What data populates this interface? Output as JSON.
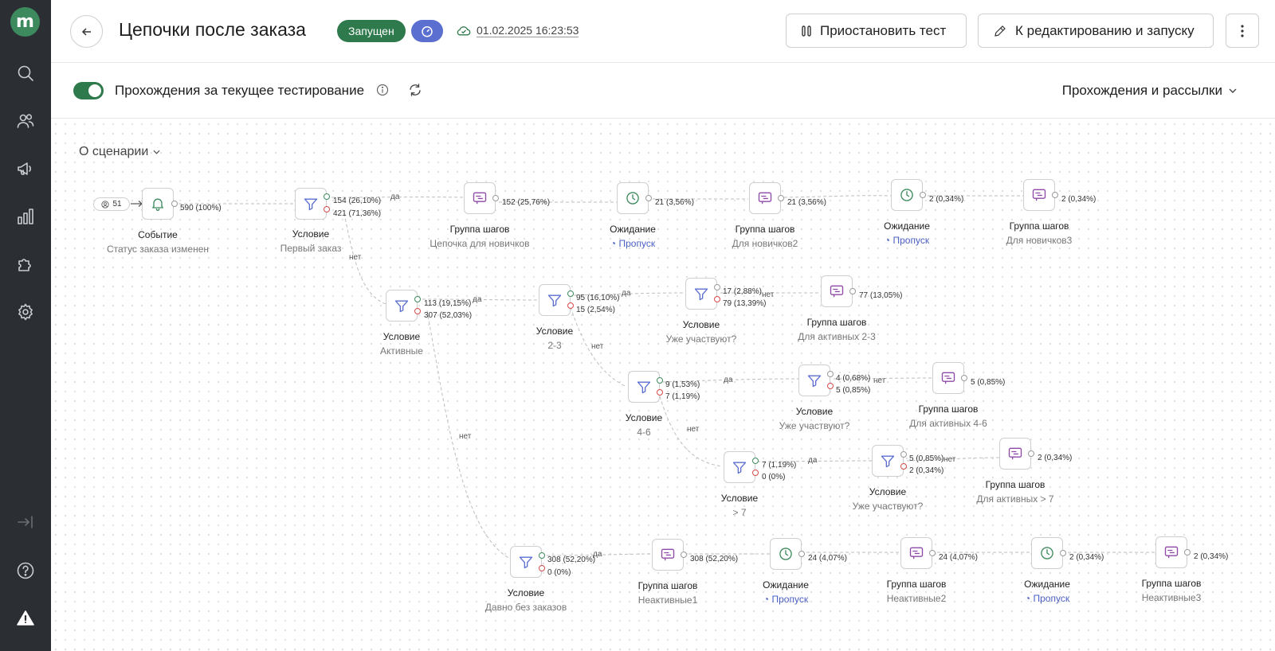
{
  "header": {
    "title": "Цепочки после заказа",
    "status": "Запущен",
    "saved_at": "01.02.2025 16:23:53",
    "pause_label": "Приостановить тест",
    "edit_label": "К редактированию и запуску"
  },
  "subbar": {
    "toggle_label": "Прохождения за текущее тестирование",
    "view_select": "Прохождения и рассылки"
  },
  "canvas": {
    "about_label": "О сценарии",
    "entry_count": "51",
    "edge_yes": "да",
    "edge_no": "нет",
    "skip_label": "Пропуск",
    "nodes": [
      {
        "id": "event",
        "title": "Событие",
        "sub": "Статус заказа изменен",
        "stats": [
          "590 (100%)"
        ]
      },
      {
        "id": "c1",
        "title": "Условие",
        "sub": "Первый заказ",
        "stats": [
          "154 (26,10%)",
          "421 (71,36%)"
        ]
      },
      {
        "id": "g1",
        "title": "Группа шагов",
        "sub": "Цепочка для новичков",
        "stats": [
          "152 (25,76%)"
        ]
      },
      {
        "id": "w1",
        "title": "Ожидание",
        "sub": "",
        "stats": [
          "21 (3,56%)"
        ]
      },
      {
        "id": "g2",
        "title": "Группа шагов",
        "sub": "Для новичков2",
        "stats": [
          "21 (3,56%)"
        ]
      },
      {
        "id": "w2",
        "title": "Ожидание",
        "sub": "",
        "stats": [
          "2 (0,34%)"
        ]
      },
      {
        "id": "g3",
        "title": "Группа шагов",
        "sub": "Для новичков3",
        "stats": [
          "2 (0,34%)"
        ]
      },
      {
        "id": "c2",
        "title": "Условие",
        "sub": "Активные",
        "stats": [
          "113 (19,15%)",
          "307 (52,03%)"
        ]
      },
      {
        "id": "c3",
        "title": "Условие",
        "sub": "2-3",
        "stats": [
          "95 (16,10%)",
          "15 (2,54%)"
        ]
      },
      {
        "id": "c4",
        "title": "Условие",
        "sub": "Уже участвуют?",
        "stats": [
          "17 (2,88%)",
          "79 (13,39%)"
        ]
      },
      {
        "id": "g4",
        "title": "Группа шагов",
        "sub": "Для активных 2-3",
        "stats": [
          "77 (13,05%)"
        ]
      },
      {
        "id": "c5",
        "title": "Условие",
        "sub": "4-6",
        "stats": [
          "9 (1,53%)",
          "7 (1,19%)"
        ]
      },
      {
        "id": "c6",
        "title": "Условие",
        "sub": "Уже участвуют?",
        "stats": [
          "4 (0,68%)",
          "5 (0,85%)"
        ]
      },
      {
        "id": "g5",
        "title": "Группа шагов",
        "sub": "Для активных 4-6",
        "stats": [
          "5 (0,85%)"
        ]
      },
      {
        "id": "c7",
        "title": "Условие",
        "sub": "> 7",
        "stats": [
          "7 (1,19%)",
          "0 (0%)"
        ]
      },
      {
        "id": "c8",
        "title": "Условие",
        "sub": "Уже участвуют?",
        "stats": [
          "5 (0,85%)",
          "2 (0,34%)"
        ]
      },
      {
        "id": "g6",
        "title": "Группа шагов",
        "sub": "Для активных > 7",
        "stats": [
          "2 (0,34%)"
        ]
      },
      {
        "id": "c9",
        "title": "Условие",
        "sub": "Давно без заказов",
        "stats": [
          "308 (52,20%)",
          "0 (0%)"
        ]
      },
      {
        "id": "g7",
        "title": "Группа шагов",
        "sub": "Неактивные1",
        "stats": [
          "308 (52,20%)"
        ]
      },
      {
        "id": "w3",
        "title": "Ожидание",
        "sub": "",
        "stats": [
          "24 (4,07%)"
        ]
      },
      {
        "id": "g8",
        "title": "Группа шагов",
        "sub": "Неактивные2",
        "stats": [
          "24 (4,07%)"
        ]
      },
      {
        "id": "w4",
        "title": "Ожидание",
        "sub": "",
        "stats": [
          "2 (0,34%)"
        ]
      },
      {
        "id": "g9",
        "title": "Группа шагов",
        "sub": "Неактивные3",
        "stats": [
          "2 (0,34%)"
        ]
      }
    ]
  },
  "icons": {
    "logo": "m",
    "node_types": [
      "bell-icon",
      "filter-icon",
      "group-icon",
      "clock-icon"
    ]
  }
}
